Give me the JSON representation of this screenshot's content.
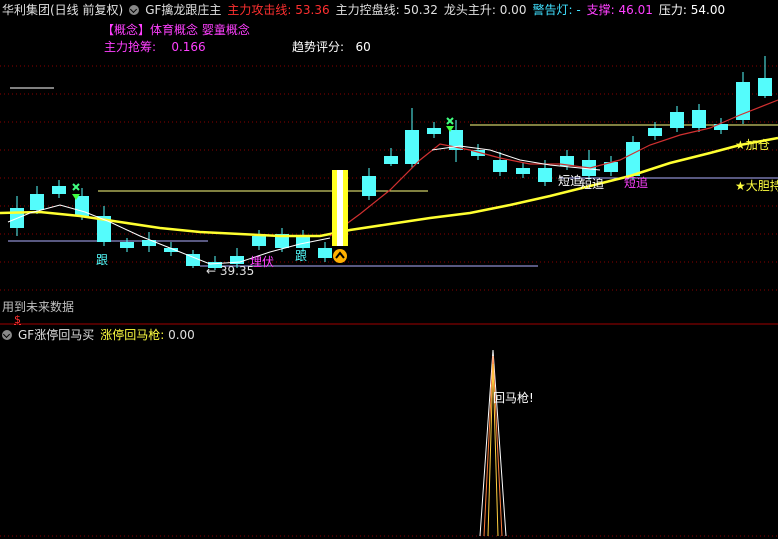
{
  "header": {
    "stock": "华利集团(日线 前复权)",
    "indicator": "GF擒龙跟庄主",
    "items": [
      {
        "label": "主力攻击线:",
        "value": "53.36",
        "color": "#ff3030"
      },
      {
        "label": "主力控盘线:",
        "value": "50.32",
        "color": "#e0e0e0"
      },
      {
        "label": "龙头主升:",
        "value": "0.00",
        "color": "#e0e0e0"
      },
      {
        "label": "警告灯:",
        "value": "-",
        "color": "#40e0ff"
      },
      {
        "label": "支撑:",
        "value": "46.01",
        "color": "#ff40ff"
      },
      {
        "label": "压力:",
        "value": "54.00",
        "color": "#ffffff"
      }
    ]
  },
  "concept": {
    "tag": "【概念】",
    "text": "体育概念 婴童概念"
  },
  "fund": {
    "label": "主力抢筹:",
    "value": "0.166"
  },
  "trend": {
    "label": "趋势评分:",
    "value": "60"
  },
  "price_labels": {
    "low": "← 39.35"
  },
  "signals": {
    "gen1": "跟",
    "gen2": "跟",
    "maifu": "埋伏",
    "duanzhui1": "短追",
    "duanzhui2": "短追",
    "duanzhui3": "短追",
    "jiacang": "★加仓",
    "dadan": "★大胆持"
  },
  "future_note": "用到未来数据",
  "dollar": "$",
  "sub": {
    "title": "GF涨停回马买",
    "line_label": "涨停回马枪:",
    "line_value": "0.00",
    "peak_label": "回马枪!"
  },
  "colors": {
    "up": "#ff3232",
    "down": "#54fcfc",
    "ma": "#ffff40",
    "mid": "#ffffff"
  }
}
